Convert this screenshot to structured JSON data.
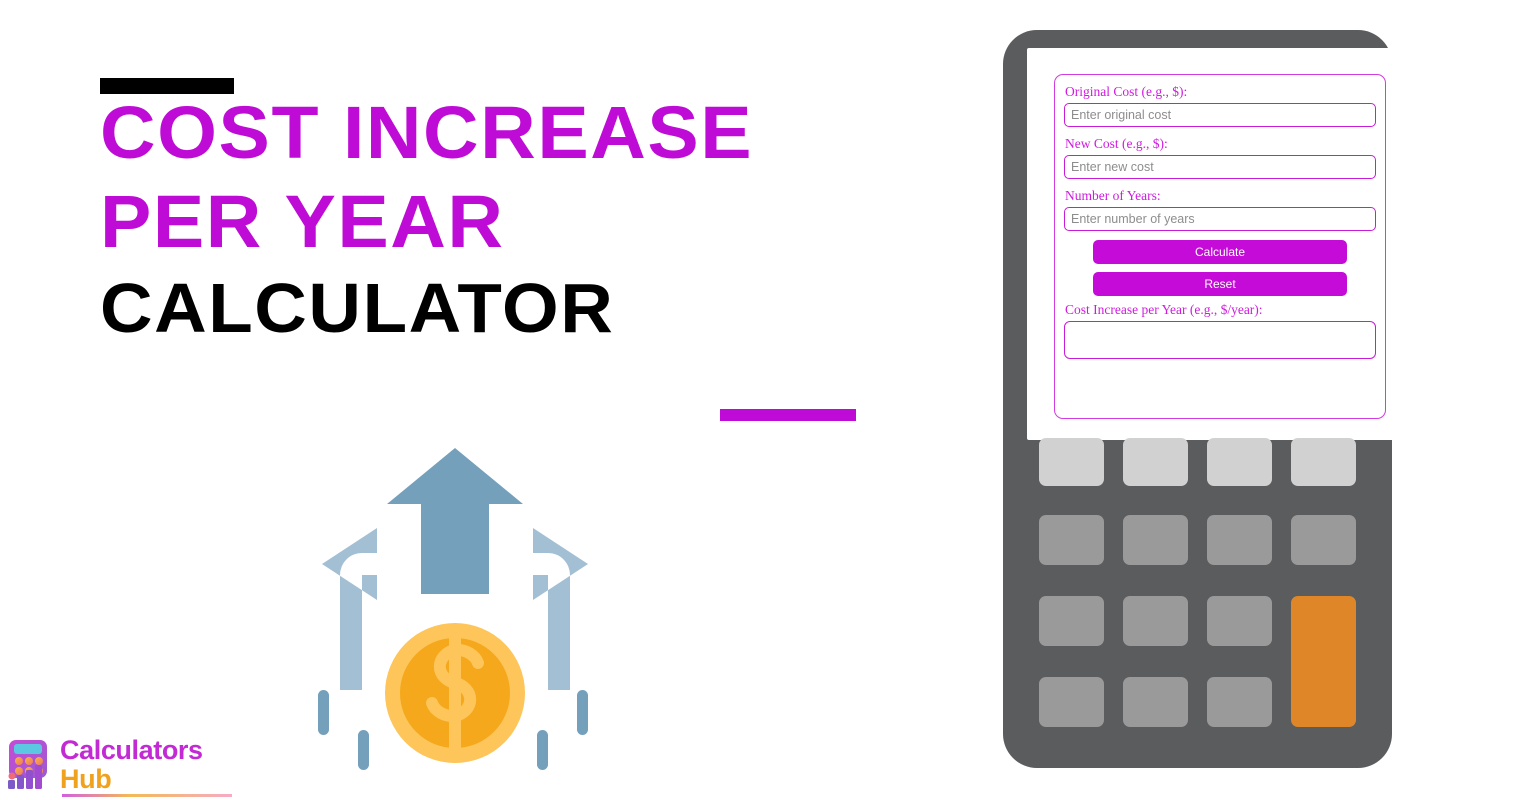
{
  "page": {
    "background_color": "#ffffff",
    "accent_purple": "#BF0BD6",
    "accent_orange": "#DF8629"
  },
  "title": {
    "line1": "Cost Increase",
    "line2": "Per Year",
    "line3": "Calculator",
    "line1_color": "#BF0BD6",
    "line2_color": "#BF0BD6",
    "line3_color": "#000000",
    "top_rule_color": "#000000",
    "bottom_rule_color": "#BF0BD6"
  },
  "illustration": {
    "name": "three-arrows-with-dollar-coin",
    "arrow_up_color": "#74A0BC",
    "arrow_side_color": "#A3BFD4",
    "coin_outer_color": "#FDC55A",
    "coin_inner_color": "#F5A81C",
    "coin_symbol": "$",
    "tick_color": "#74A0BC"
  },
  "logo": {
    "word1": "Calculators",
    "word2": "Hub",
    "word1_color": "#C22BD4",
    "word2_color": "#F0A21E",
    "icon": "calculator-bar-chart-icon"
  },
  "calculator": {
    "body_color": "#5B5C5E",
    "screen_color": "#ffffff",
    "form": {
      "border_color": "#D23BE0",
      "fields": [
        {
          "name": "original-cost",
          "label": "Original Cost (e.g., $):",
          "placeholder": "Enter original cost",
          "value": ""
        },
        {
          "name": "new-cost",
          "label": "New Cost (e.g., $):",
          "placeholder": "Enter new cost",
          "value": ""
        },
        {
          "name": "number-of-years",
          "label": "Number of Years:",
          "placeholder": "Enter number of years",
          "value": ""
        }
      ],
      "buttons": [
        {
          "name": "calculate",
          "label": "Calculate"
        },
        {
          "name": "reset",
          "label": "Reset"
        }
      ],
      "result": {
        "label": "Cost Increase per Year (e.g., $/year):",
        "value": "",
        "placeholder": ""
      }
    },
    "keypad": {
      "rows": 4,
      "columns": 4,
      "light_key_color": "#D1D1D1",
      "mid_key_color": "#9A9A9A",
      "accent_key_color": "#DF8629",
      "keys": [
        {
          "row": 1,
          "col": 1,
          "style": "light",
          "label": ""
        },
        {
          "row": 1,
          "col": 2,
          "style": "light",
          "label": ""
        },
        {
          "row": 1,
          "col": 3,
          "style": "light",
          "label": ""
        },
        {
          "row": 1,
          "col": 4,
          "style": "light",
          "label": ""
        },
        {
          "row": 2,
          "col": 1,
          "style": "mid",
          "label": ""
        },
        {
          "row": 2,
          "col": 2,
          "style": "mid",
          "label": ""
        },
        {
          "row": 2,
          "col": 3,
          "style": "mid",
          "label": ""
        },
        {
          "row": 2,
          "col": 4,
          "style": "mid",
          "label": ""
        },
        {
          "row": 3,
          "col": 1,
          "style": "mid",
          "label": ""
        },
        {
          "row": 3,
          "col": 2,
          "style": "mid",
          "label": ""
        },
        {
          "row": 3,
          "col": 3,
          "style": "mid",
          "label": ""
        },
        {
          "row": 3,
          "col": 4,
          "style": "accent",
          "label": "",
          "span_rows": 2
        },
        {
          "row": 4,
          "col": 1,
          "style": "mid",
          "label": ""
        },
        {
          "row": 4,
          "col": 2,
          "style": "mid",
          "label": ""
        },
        {
          "row": 4,
          "col": 3,
          "style": "mid",
          "label": ""
        }
      ]
    }
  }
}
